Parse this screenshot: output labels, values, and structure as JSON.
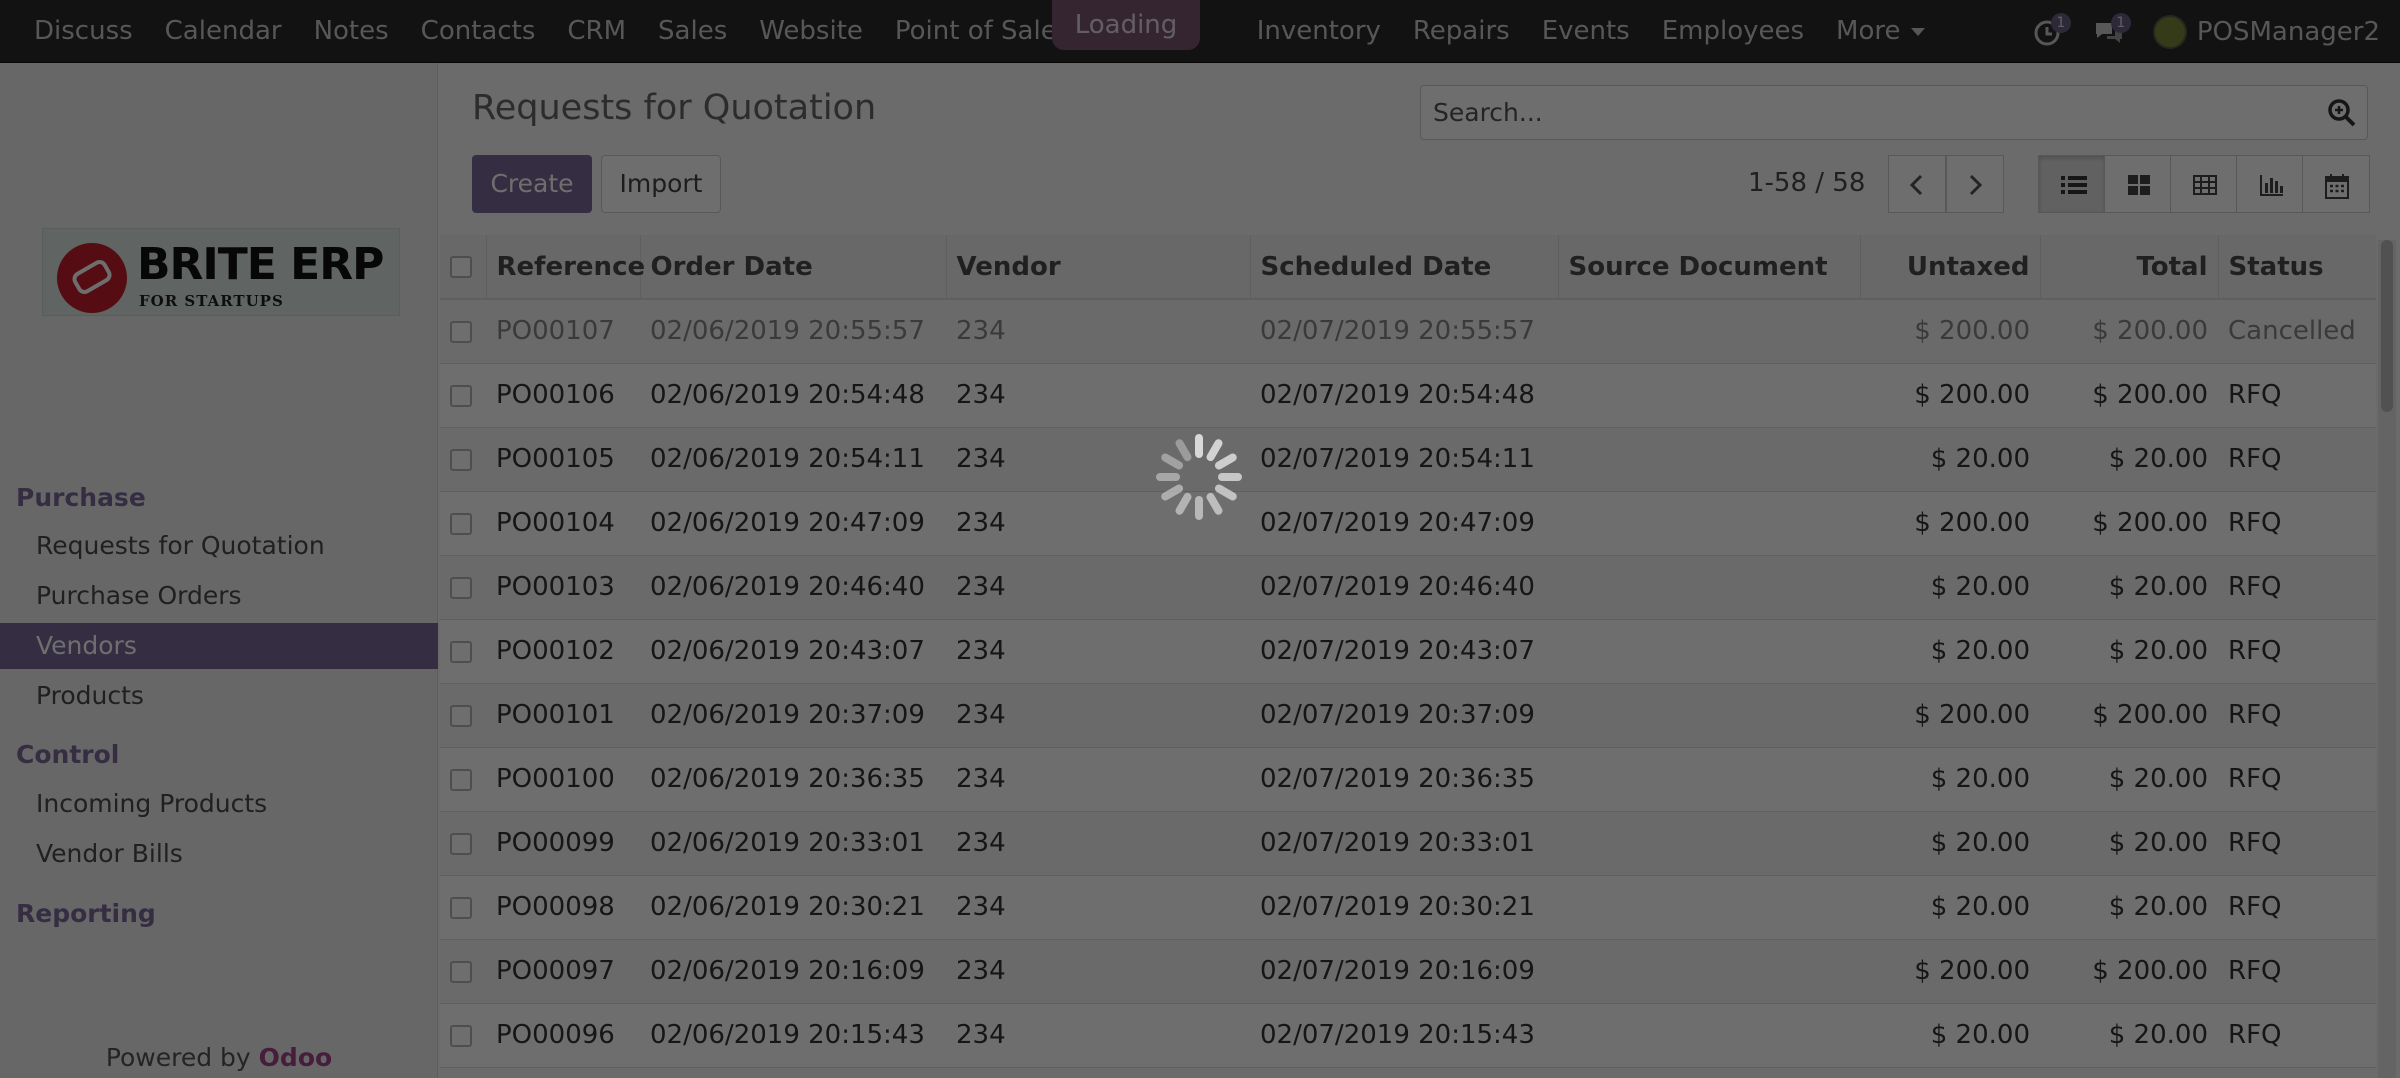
{
  "topnav": {
    "apps": [
      "Discuss",
      "Calendar",
      "Notes",
      "Contacts",
      "CRM",
      "Sales",
      "Website",
      "Point of Sale",
      "Inventory",
      "Repairs",
      "Events",
      "Employees"
    ],
    "more_label": "More",
    "loading_label": "Loading",
    "activity_count": "1",
    "messages_count": "1",
    "user_name": "POSManager2"
  },
  "sidebar": {
    "logo_name": "BRITE ERP",
    "logo_tag": "FOR STARTUPS",
    "sections": [
      {
        "title": "Purchase",
        "items": [
          "Requests for Quotation",
          "Purchase Orders",
          "Vendors",
          "Products"
        ]
      },
      {
        "title": "Control",
        "items": [
          "Incoming Products",
          "Vendor Bills"
        ]
      },
      {
        "title": "Reporting",
        "items": []
      }
    ],
    "active_item": "Vendors",
    "powered_prefix": "Powered by",
    "powered_brand": "Odoo"
  },
  "control_panel": {
    "title": "Requests for Quotation",
    "create_label": "Create",
    "import_label": "Import",
    "search_placeholder": "Search...",
    "pager_text": "1-58 / 58"
  },
  "table": {
    "columns": [
      "Reference",
      "Order Date",
      "Vendor",
      "Scheduled Date",
      "Source Document",
      "Untaxed",
      "Total",
      "Status"
    ],
    "rows": [
      {
        "ref": "PO00107",
        "order_date": "02/06/2019 20:55:57",
        "vendor": "234",
        "scheduled": "02/07/2019 20:55:57",
        "source": "",
        "untaxed": "$ 200.00",
        "total": "$ 200.00",
        "status": "Cancelled"
      },
      {
        "ref": "PO00106",
        "order_date": "02/06/2019 20:54:48",
        "vendor": "234",
        "scheduled": "02/07/2019 20:54:48",
        "source": "",
        "untaxed": "$ 200.00",
        "total": "$ 200.00",
        "status": "RFQ"
      },
      {
        "ref": "PO00105",
        "order_date": "02/06/2019 20:54:11",
        "vendor": "234",
        "scheduled": "02/07/2019 20:54:11",
        "source": "",
        "untaxed": "$ 20.00",
        "total": "$ 20.00",
        "status": "RFQ"
      },
      {
        "ref": "PO00104",
        "order_date": "02/06/2019 20:47:09",
        "vendor": "234",
        "scheduled": "02/07/2019 20:47:09",
        "source": "",
        "untaxed": "$ 200.00",
        "total": "$ 200.00",
        "status": "RFQ"
      },
      {
        "ref": "PO00103",
        "order_date": "02/06/2019 20:46:40",
        "vendor": "234",
        "scheduled": "02/07/2019 20:46:40",
        "source": "",
        "untaxed": "$ 20.00",
        "total": "$ 20.00",
        "status": "RFQ"
      },
      {
        "ref": "PO00102",
        "order_date": "02/06/2019 20:43:07",
        "vendor": "234",
        "scheduled": "02/07/2019 20:43:07",
        "source": "",
        "untaxed": "$ 20.00",
        "total": "$ 20.00",
        "status": "RFQ"
      },
      {
        "ref": "PO00101",
        "order_date": "02/06/2019 20:37:09",
        "vendor": "234",
        "scheduled": "02/07/2019 20:37:09",
        "source": "",
        "untaxed": "$ 200.00",
        "total": "$ 200.00",
        "status": "RFQ"
      },
      {
        "ref": "PO00100",
        "order_date": "02/06/2019 20:36:35",
        "vendor": "234",
        "scheduled": "02/07/2019 20:36:35",
        "source": "",
        "untaxed": "$ 20.00",
        "total": "$ 20.00",
        "status": "RFQ"
      },
      {
        "ref": "PO00099",
        "order_date": "02/06/2019 20:33:01",
        "vendor": "234",
        "scheduled": "02/07/2019 20:33:01",
        "source": "",
        "untaxed": "$ 20.00",
        "total": "$ 20.00",
        "status": "RFQ"
      },
      {
        "ref": "PO00098",
        "order_date": "02/06/2019 20:30:21",
        "vendor": "234",
        "scheduled": "02/07/2019 20:30:21",
        "source": "",
        "untaxed": "$ 20.00",
        "total": "$ 20.00",
        "status": "RFQ"
      },
      {
        "ref": "PO00097",
        "order_date": "02/06/2019 20:16:09",
        "vendor": "234",
        "scheduled": "02/07/2019 20:16:09",
        "source": "",
        "untaxed": "$ 200.00",
        "total": "$ 200.00",
        "status": "RFQ"
      },
      {
        "ref": "PO00096",
        "order_date": "02/06/2019 20:15:43",
        "vendor": "234",
        "scheduled": "02/07/2019 20:15:43",
        "source": "",
        "untaxed": "$ 20.00",
        "total": "$ 20.00",
        "status": "RFQ"
      }
    ]
  }
}
